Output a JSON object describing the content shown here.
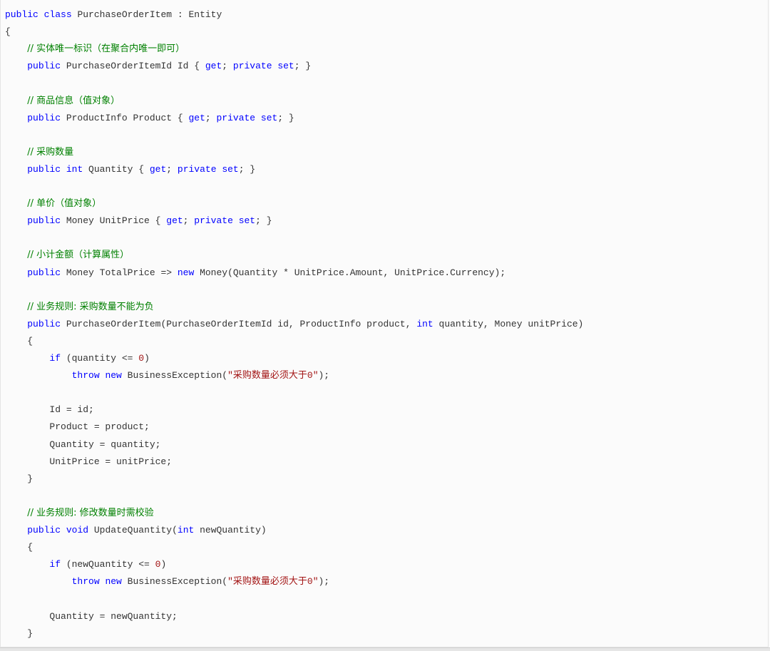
{
  "colors": {
    "background": "#fbfbfb",
    "keyword": "#0000ff",
    "comment": "#008000",
    "string": "#a31515",
    "number": "#a31515",
    "plain": "#333333"
  },
  "code": {
    "language": "csharp",
    "lines": [
      {
        "tokens": [
          {
            "t": "kw",
            "v": "public"
          },
          {
            "t": "tx",
            "v": " "
          },
          {
            "t": "kw",
            "v": "class"
          },
          {
            "t": "tx",
            "v": " PurchaseOrderItem : Entity"
          }
        ]
      },
      {
        "tokens": [
          {
            "t": "tx",
            "v": "{"
          }
        ]
      },
      {
        "tokens": [
          {
            "t": "tx",
            "v": "    "
          },
          {
            "t": "cm",
            "v": "// 实体唯一标识（在聚合内唯一即可）"
          }
        ]
      },
      {
        "tokens": [
          {
            "t": "tx",
            "v": "    "
          },
          {
            "t": "kw",
            "v": "public"
          },
          {
            "t": "tx",
            "v": " PurchaseOrderItemId Id { "
          },
          {
            "t": "kw",
            "v": "get"
          },
          {
            "t": "tx",
            "v": "; "
          },
          {
            "t": "kw",
            "v": "private"
          },
          {
            "t": "tx",
            "v": " "
          },
          {
            "t": "kw",
            "v": "set"
          },
          {
            "t": "tx",
            "v": "; }"
          }
        ]
      },
      {
        "tokens": []
      },
      {
        "tokens": [
          {
            "t": "tx",
            "v": "    "
          },
          {
            "t": "cm",
            "v": "// 商品信息（值对象）"
          }
        ]
      },
      {
        "tokens": [
          {
            "t": "tx",
            "v": "    "
          },
          {
            "t": "kw",
            "v": "public"
          },
          {
            "t": "tx",
            "v": " ProductInfo Product { "
          },
          {
            "t": "kw",
            "v": "get"
          },
          {
            "t": "tx",
            "v": "; "
          },
          {
            "t": "kw",
            "v": "private"
          },
          {
            "t": "tx",
            "v": " "
          },
          {
            "t": "kw",
            "v": "set"
          },
          {
            "t": "tx",
            "v": "; }"
          }
        ]
      },
      {
        "tokens": []
      },
      {
        "tokens": [
          {
            "t": "tx",
            "v": "    "
          },
          {
            "t": "cm",
            "v": "// 采购数量"
          }
        ]
      },
      {
        "tokens": [
          {
            "t": "tx",
            "v": "    "
          },
          {
            "t": "kw",
            "v": "public"
          },
          {
            "t": "tx",
            "v": " "
          },
          {
            "t": "kw",
            "v": "int"
          },
          {
            "t": "tx",
            "v": " Quantity { "
          },
          {
            "t": "kw",
            "v": "get"
          },
          {
            "t": "tx",
            "v": "; "
          },
          {
            "t": "kw",
            "v": "private"
          },
          {
            "t": "tx",
            "v": " "
          },
          {
            "t": "kw",
            "v": "set"
          },
          {
            "t": "tx",
            "v": "; }"
          }
        ]
      },
      {
        "tokens": []
      },
      {
        "tokens": [
          {
            "t": "tx",
            "v": "    "
          },
          {
            "t": "cm",
            "v": "// 单价（值对象）"
          }
        ]
      },
      {
        "tokens": [
          {
            "t": "tx",
            "v": "    "
          },
          {
            "t": "kw",
            "v": "public"
          },
          {
            "t": "tx",
            "v": " Money UnitPrice { "
          },
          {
            "t": "kw",
            "v": "get"
          },
          {
            "t": "tx",
            "v": "; "
          },
          {
            "t": "kw",
            "v": "private"
          },
          {
            "t": "tx",
            "v": " "
          },
          {
            "t": "kw",
            "v": "set"
          },
          {
            "t": "tx",
            "v": "; }"
          }
        ]
      },
      {
        "tokens": []
      },
      {
        "tokens": [
          {
            "t": "tx",
            "v": "    "
          },
          {
            "t": "cm",
            "v": "// 小计金额（计算属性）"
          }
        ]
      },
      {
        "tokens": [
          {
            "t": "tx",
            "v": "    "
          },
          {
            "t": "kw",
            "v": "public"
          },
          {
            "t": "tx",
            "v": " Money TotalPrice => "
          },
          {
            "t": "kw",
            "v": "new"
          },
          {
            "t": "tx",
            "v": " Money(Quantity * UnitPrice.Amount, UnitPrice.Currency);"
          }
        ]
      },
      {
        "tokens": []
      },
      {
        "tokens": [
          {
            "t": "tx",
            "v": "    "
          },
          {
            "t": "cm",
            "v": "// 业务规则: 采购数量不能为负"
          }
        ]
      },
      {
        "tokens": [
          {
            "t": "tx",
            "v": "    "
          },
          {
            "t": "kw",
            "v": "public"
          },
          {
            "t": "tx",
            "v": " PurchaseOrderItem(PurchaseOrderItemId id, ProductInfo product, "
          },
          {
            "t": "kw",
            "v": "int"
          },
          {
            "t": "tx",
            "v": " quantity, Money unitPrice)"
          }
        ]
      },
      {
        "tokens": [
          {
            "t": "tx",
            "v": "    {"
          }
        ]
      },
      {
        "tokens": [
          {
            "t": "tx",
            "v": "        "
          },
          {
            "t": "kw",
            "v": "if"
          },
          {
            "t": "tx",
            "v": " (quantity <= "
          },
          {
            "t": "num",
            "v": "0"
          },
          {
            "t": "tx",
            "v": ")"
          }
        ]
      },
      {
        "tokens": [
          {
            "t": "tx",
            "v": "            "
          },
          {
            "t": "kw",
            "v": "throw"
          },
          {
            "t": "tx",
            "v": " "
          },
          {
            "t": "kw",
            "v": "new"
          },
          {
            "t": "tx",
            "v": " BusinessException("
          },
          {
            "t": "str",
            "v": "\"采购数量必须大于0\""
          },
          {
            "t": "tx",
            "v": ");"
          }
        ]
      },
      {
        "tokens": []
      },
      {
        "tokens": [
          {
            "t": "tx",
            "v": "        Id = id;"
          }
        ]
      },
      {
        "tokens": [
          {
            "t": "tx",
            "v": "        Product = product;"
          }
        ]
      },
      {
        "tokens": [
          {
            "t": "tx",
            "v": "        Quantity = quantity;"
          }
        ]
      },
      {
        "tokens": [
          {
            "t": "tx",
            "v": "        UnitPrice = unitPrice;"
          }
        ]
      },
      {
        "tokens": [
          {
            "t": "tx",
            "v": "    }"
          }
        ]
      },
      {
        "tokens": []
      },
      {
        "tokens": [
          {
            "t": "tx",
            "v": "    "
          },
          {
            "t": "cm",
            "v": "// 业务规则: 修改数量时需校验"
          }
        ]
      },
      {
        "tokens": [
          {
            "t": "tx",
            "v": "    "
          },
          {
            "t": "kw",
            "v": "public"
          },
          {
            "t": "tx",
            "v": " "
          },
          {
            "t": "kw",
            "v": "void"
          },
          {
            "t": "tx",
            "v": " UpdateQuantity("
          },
          {
            "t": "kw",
            "v": "int"
          },
          {
            "t": "tx",
            "v": " newQuantity)"
          }
        ]
      },
      {
        "tokens": [
          {
            "t": "tx",
            "v": "    {"
          }
        ]
      },
      {
        "tokens": [
          {
            "t": "tx",
            "v": "        "
          },
          {
            "t": "kw",
            "v": "if"
          },
          {
            "t": "tx",
            "v": " (newQuantity <= "
          },
          {
            "t": "num",
            "v": "0"
          },
          {
            "t": "tx",
            "v": ")"
          }
        ]
      },
      {
        "tokens": [
          {
            "t": "tx",
            "v": "            "
          },
          {
            "t": "kw",
            "v": "throw"
          },
          {
            "t": "tx",
            "v": " "
          },
          {
            "t": "kw",
            "v": "new"
          },
          {
            "t": "tx",
            "v": " BusinessException("
          },
          {
            "t": "str",
            "v": "\"采购数量必须大于0\""
          },
          {
            "t": "tx",
            "v": ");"
          }
        ]
      },
      {
        "tokens": []
      },
      {
        "tokens": [
          {
            "t": "tx",
            "v": "        Quantity = newQuantity;"
          }
        ]
      },
      {
        "tokens": [
          {
            "t": "tx",
            "v": "    }"
          }
        ]
      }
    ]
  }
}
